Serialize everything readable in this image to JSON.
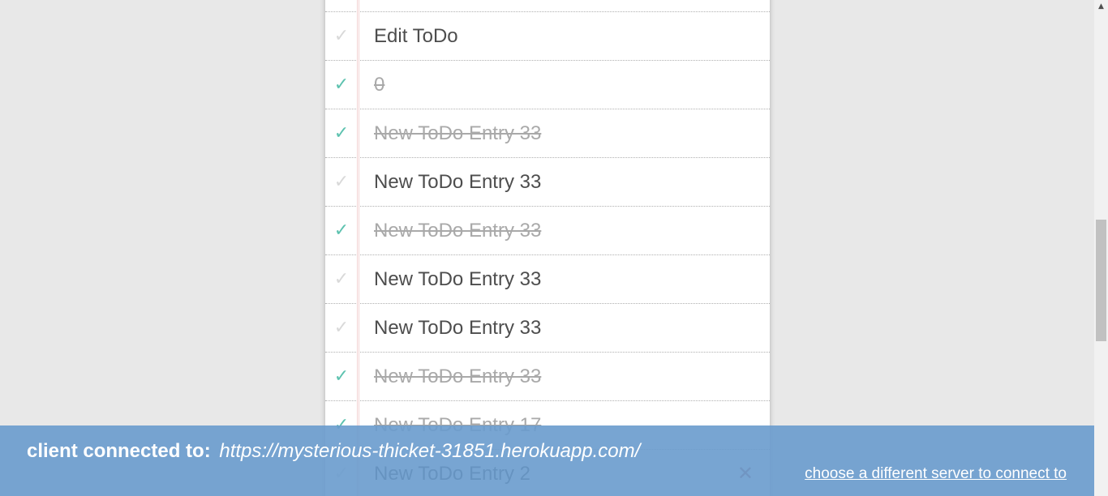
{
  "todo_list": {
    "items": [
      {
        "title": "",
        "completed": false,
        "show_destroy": false
      },
      {
        "title": "Edit ToDo",
        "completed": false,
        "show_destroy": false
      },
      {
        "title": "0",
        "completed": true,
        "show_destroy": false
      },
      {
        "title": "New ToDo Entry 33",
        "completed": true,
        "show_destroy": false
      },
      {
        "title": "New ToDo Entry 33",
        "completed": false,
        "show_destroy": false
      },
      {
        "title": "New ToDo Entry 33",
        "completed": true,
        "show_destroy": false
      },
      {
        "title": "New ToDo Entry 33",
        "completed": false,
        "show_destroy": false
      },
      {
        "title": "New ToDo Entry 33",
        "completed": false,
        "show_destroy": false
      },
      {
        "title": "New ToDo Entry 33",
        "completed": true,
        "show_destroy": false
      },
      {
        "title": "New ToDo Entry 17",
        "completed": true,
        "show_destroy": false
      },
      {
        "title": "New ToDo Entry 2",
        "completed": false,
        "show_destroy": true
      }
    ],
    "toggle_glyph": "✓",
    "destroy_glyph": "✕"
  },
  "footer": {
    "label": "client connected to:",
    "server_url": "https://mysterious-thicket-31851.herokuapp.com/",
    "switch_link": "choose a different server to connect to"
  },
  "colors": {
    "check_done": "#5dc2af",
    "check_todo": "#d9d9d9",
    "destroy": "#af5b5e",
    "footer_bg": "#699bcd"
  },
  "icons": {
    "toggle": "check-icon",
    "destroy": "close-icon",
    "scroll_up": "scroll-up-arrow-icon"
  }
}
